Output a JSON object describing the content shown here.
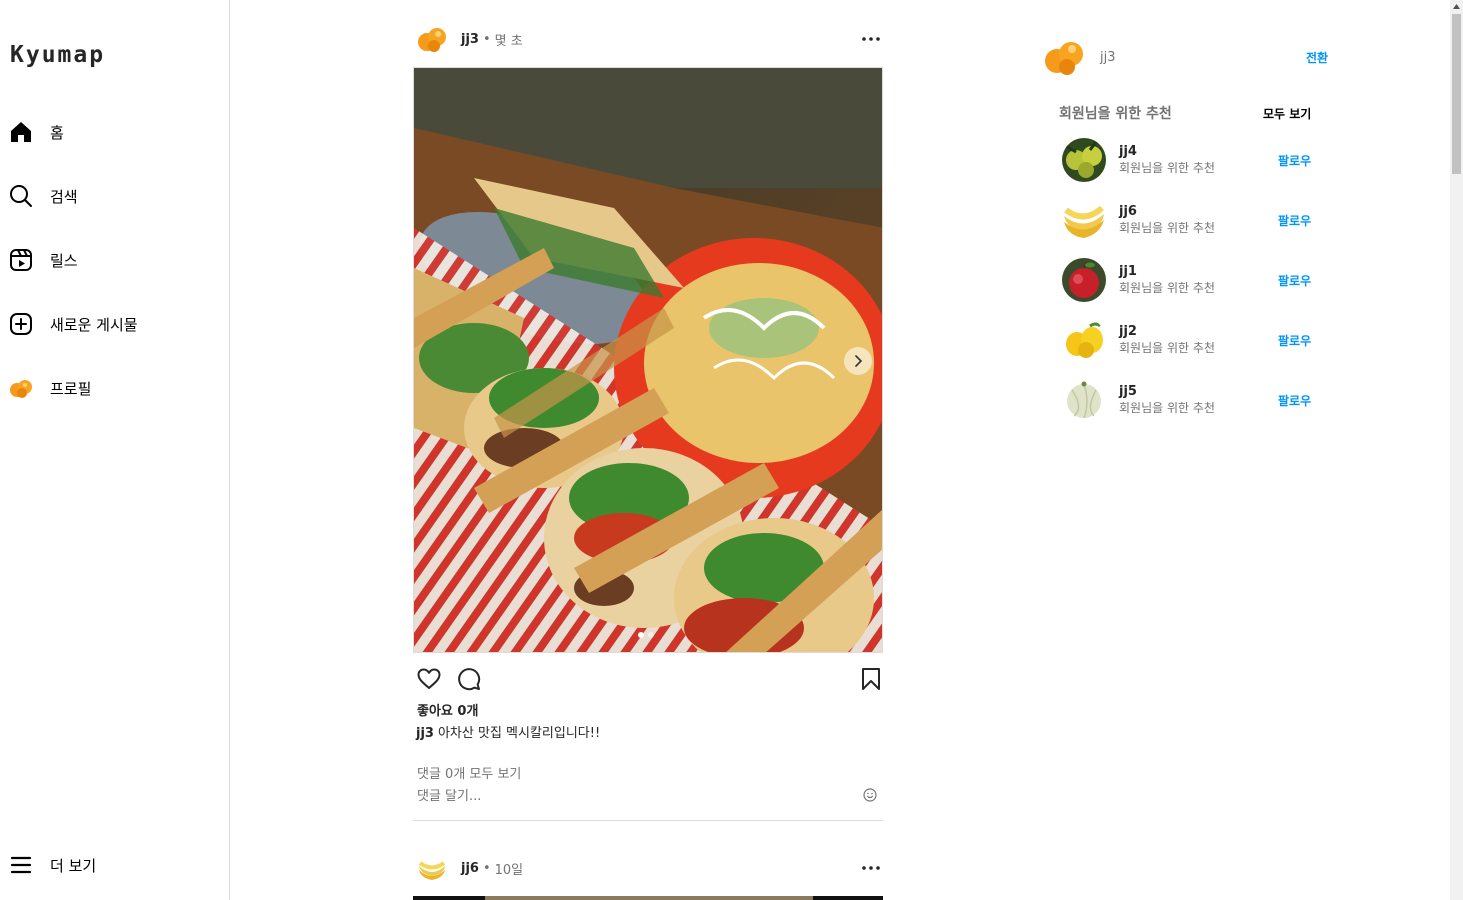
{
  "app": {
    "logo": "Kyumap"
  },
  "sidebar": {
    "items": [
      {
        "label": "홈",
        "icon": "home-icon"
      },
      {
        "label": "검색",
        "icon": "search-icon"
      },
      {
        "label": "릴스",
        "icon": "reels-icon"
      },
      {
        "label": "새로운 게시물",
        "icon": "plus-square-icon"
      },
      {
        "label": "프로필",
        "icon": "profile-avatar-icon"
      }
    ],
    "more": {
      "label": "더 보기",
      "icon": "menu-icon"
    }
  },
  "feed": {
    "posts": [
      {
        "username": "jj3",
        "separator": "•",
        "time": "몇 초",
        "likes": "좋아요 0개",
        "caption_user": "jj3",
        "caption_text": "아차산 맛집 멕시칼리입니다!!",
        "view_comments": "댓글 0개 모두 보기",
        "comment_placeholder": "댓글 달기...",
        "carousel": {
          "current": 1,
          "total": 2
        }
      },
      {
        "username": "jj6",
        "separator": "•",
        "time": "10일"
      }
    ]
  },
  "right_panel": {
    "me": {
      "username": "jj3",
      "switch_label": "전환"
    },
    "suggestions_title": "회원님을 위한 추천",
    "see_all": "모두 보기",
    "suggestions": [
      {
        "username": "jj4",
        "sub": "회원님을 위한 추천",
        "follow": "팔로우",
        "avatar": "lime-fruit"
      },
      {
        "username": "jj6",
        "sub": "회원님을 위한 추천",
        "follow": "팔로우",
        "avatar": "banana-fruit"
      },
      {
        "username": "jj1",
        "sub": "회원님을 위한 추천",
        "follow": "팔로우",
        "avatar": "apple-fruit"
      },
      {
        "username": "jj2",
        "sub": "회원님을 위한 추천",
        "follow": "팔로우",
        "avatar": "lemon-fruit"
      },
      {
        "username": "jj5",
        "sub": "회원님을 위한 추천",
        "follow": "팔로우",
        "avatar": "melon-fruit"
      }
    ]
  },
  "colors": {
    "accent": "#0095f6",
    "text": "#262626",
    "muted": "#737373",
    "border": "#dbdbdb"
  }
}
